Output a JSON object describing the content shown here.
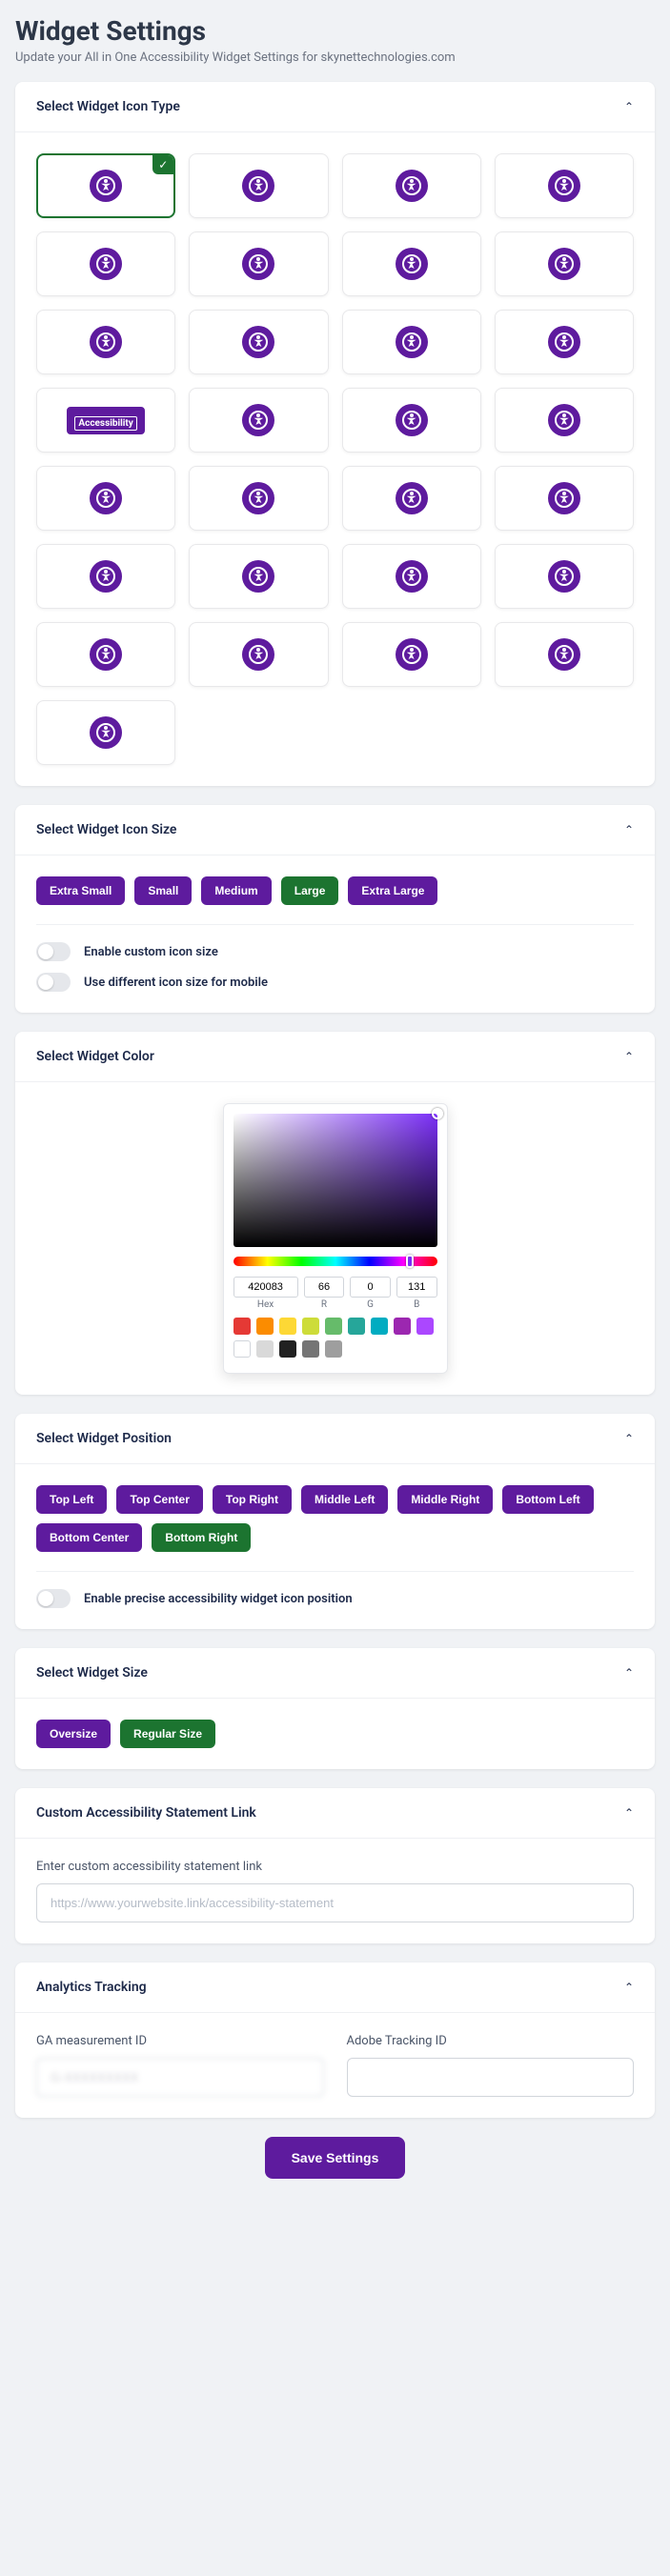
{
  "header": {
    "title": "Widget Settings",
    "subtitle": "Update your All in One Accessibility Widget Settings for skynettechnologies.com"
  },
  "icon_type": {
    "title": "Select Widget Icon Type",
    "selected_index": 0,
    "badge_label": "Accessibility",
    "icons": [
      "accessibility-person",
      "wheelchair",
      "eye-slash",
      "circle-a",
      "person-standing",
      "cursor-target",
      "gear-circle",
      "aa-text",
      "sliders",
      "target",
      "braille",
      "wheelchair-motion",
      "accessibility-badge",
      "globe",
      "vision",
      "wheelchair-alt",
      "wheelchair-alt2",
      "wheelchair-alt3",
      "wheelchair-alt4",
      "wheelchair-alt5",
      "wheelchair-alt6",
      "wheelchair-alt7",
      "wheelchair-alt8",
      "wheelchair-alt9",
      "wheelchair-alt10",
      "wheelchair-alt11",
      "wheelchair-alt12",
      "wheelchair-alt13",
      "wheelchair-alt14"
    ]
  },
  "icon_size": {
    "title": "Select Widget Icon Size",
    "options": [
      "Extra Small",
      "Small",
      "Medium",
      "Large",
      "Extra Large"
    ],
    "selected": "Large",
    "toggle1": "Enable custom icon size",
    "toggle2": "Use different icon size for mobile"
  },
  "widget_color": {
    "title": "Select Widget Color",
    "hex": "420083",
    "r": "66",
    "g": "0",
    "b": "131",
    "labels": {
      "hex": "Hex",
      "r": "R",
      "g": "G",
      "b": "B"
    },
    "swatches_row1": [
      "#e53935",
      "#fb8c00",
      "#fdd835",
      "#cddc39",
      "#66bb6a",
      "#26a69a",
      "#00acc1",
      "#9c27b0",
      "#ab47ff"
    ],
    "swatches_row2": [
      "#ffffff",
      "#d9d9d9",
      "#212121",
      "#757575",
      "#9e9e9e"
    ]
  },
  "widget_position": {
    "title": "Select Widget Position",
    "options": [
      "Top Left",
      "Top Center",
      "Top Right",
      "Middle Left",
      "Middle Right",
      "Bottom Left",
      "Bottom Center",
      "Bottom Right"
    ],
    "selected": "Bottom Right",
    "toggle": "Enable precise accessibility widget icon position"
  },
  "widget_size": {
    "title": "Select Widget Size",
    "options": [
      "Oversize",
      "Regular Size"
    ],
    "selected": "Regular Size"
  },
  "custom_link": {
    "title": "Custom Accessibility Statement Link",
    "label": "Enter custom accessibility statement link",
    "placeholder": "https://www.yourwebsite.link/accessibility-statement"
  },
  "analytics": {
    "title": "Analytics Tracking",
    "ga_label": "GA measurement ID",
    "ga_value": "G-XXXXXXXXX",
    "adobe_label": "Adobe Tracking ID"
  },
  "save_label": "Save Settings"
}
